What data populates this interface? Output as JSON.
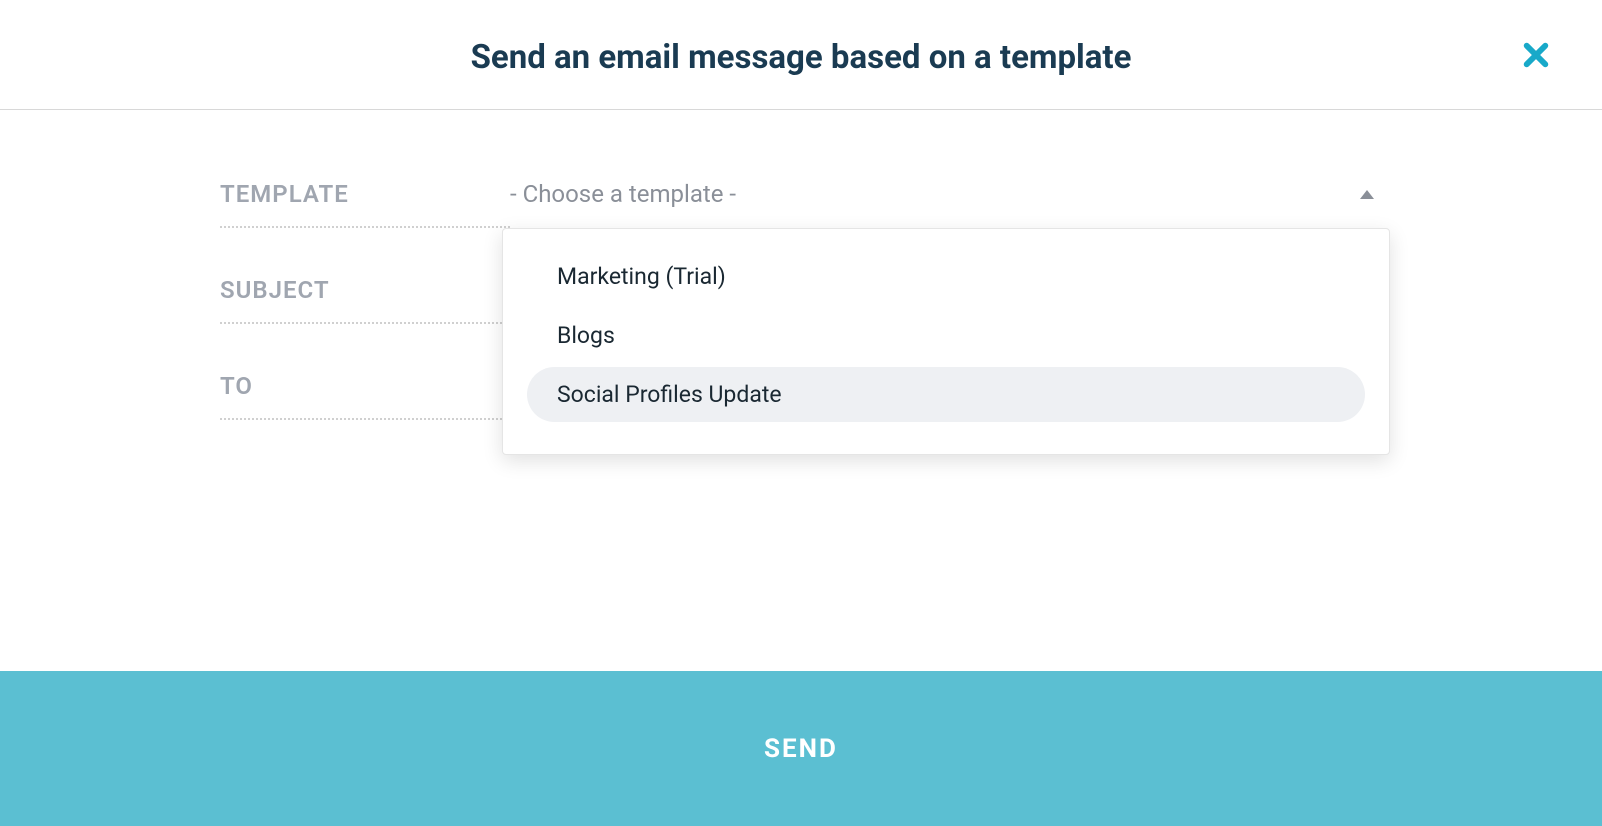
{
  "modal": {
    "title": "Send an email message based on a template",
    "labels": {
      "template": "TEMPLATE",
      "subject": "SUBJECT",
      "to": "TO"
    },
    "templateSelect": {
      "placeholder": "- Choose a template -",
      "options": [
        "Marketing (Trial)",
        "Blogs",
        "Social Profiles Update"
      ],
      "highlightedIndex": 2
    },
    "footer": {
      "sendLabel": "SEND"
    }
  }
}
